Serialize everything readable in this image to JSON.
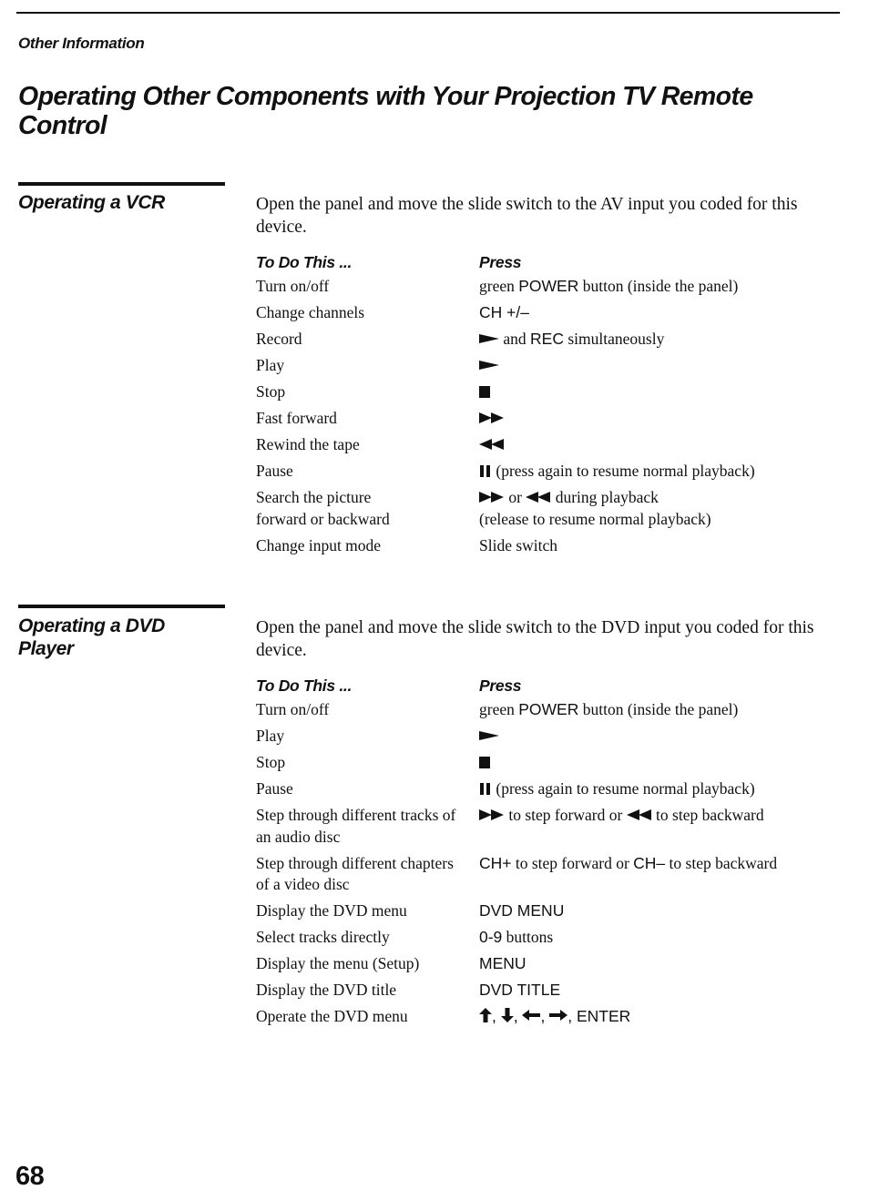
{
  "running_head": "Other Information",
  "page_title": "Operating Other Components with Your Projection TV Remote Control",
  "page_number": "68",
  "icons": {
    "play": "play-icon (►)",
    "stop": "stop-icon (■)",
    "fast_forward": "fast-forward-icon (►►)",
    "rewind": "rewind-icon (◄◄)",
    "pause": "pause-icon (❚❚)",
    "arrows": [
      "arrow-up-icon (↑)",
      "arrow-down-icon (↓)",
      "arrow-left-icon (←)",
      "arrow-right-icon (→)"
    ]
  },
  "vcr": {
    "title": "Operating a VCR",
    "intro": "Open the panel and move the slide switch to the AV input you coded for this device.",
    "col_todo": "To Do This ...",
    "col_press": "Press",
    "rows": [
      {
        "todo": "Turn on/off",
        "p1": "green ",
        "k1": "POWER",
        "p2": " button (inside the panel)"
      },
      {
        "todo": "Change channels",
        "k1": "CH +/–"
      },
      {
        "todo": "Record",
        "p2": " and ",
        "k2": "REC",
        "p3": " simultaneously"
      },
      {
        "todo": "Play"
      },
      {
        "todo": "Stop"
      },
      {
        "todo": "Fast forward"
      },
      {
        "todo": "Rewind the tape"
      },
      {
        "todo": "Pause",
        "p1": " (press again to resume normal playback)"
      },
      {
        "todo_line1": "Search the picture",
        "todo_line2": "forward or backward",
        "p1": " or ",
        "p2": " during playback",
        "line2": "(release to resume normal playback)"
      },
      {
        "todo": "Change input mode",
        "p1": "Slide switch"
      }
    ]
  },
  "dvd": {
    "title_line1": "Operating a DVD",
    "title_line2": "Player",
    "intro": "Open the panel and move the slide switch to the DVD input you coded for this device.",
    "col_todo": "To Do This ...",
    "col_press": "Press",
    "rows": [
      {
        "todo": "Turn on/off",
        "p1": "green ",
        "k1": "POWER",
        "p2": " button (inside the panel)"
      },
      {
        "todo": "Play"
      },
      {
        "todo": "Stop"
      },
      {
        "todo": "Pause",
        "p1": " (press again to resume normal playback)"
      },
      {
        "todo_line1": "Step through different tracks of",
        "todo_line2": "an audio disc",
        "p1": " to step forward or ",
        "p2": " to step backward"
      },
      {
        "todo_line1": "Step through different chapters",
        "todo_line2": "of a video disc",
        "k1": "CH+",
        "p1": " to step forward or ",
        "k2": "CH–",
        "p2": " to step backward"
      },
      {
        "todo": "Display the DVD menu",
        "k1": "DVD MENU"
      },
      {
        "todo": "Select tracks directly",
        "k1": "0-9",
        "p1": " buttons"
      },
      {
        "todo": "Display the menu (Setup)",
        "k1": "MENU"
      },
      {
        "todo": "Display the DVD title",
        "k1": "DVD TITLE"
      },
      {
        "todo": "Operate the DVD menu",
        "sep": ", ",
        "k1": "ENTER"
      }
    ]
  }
}
